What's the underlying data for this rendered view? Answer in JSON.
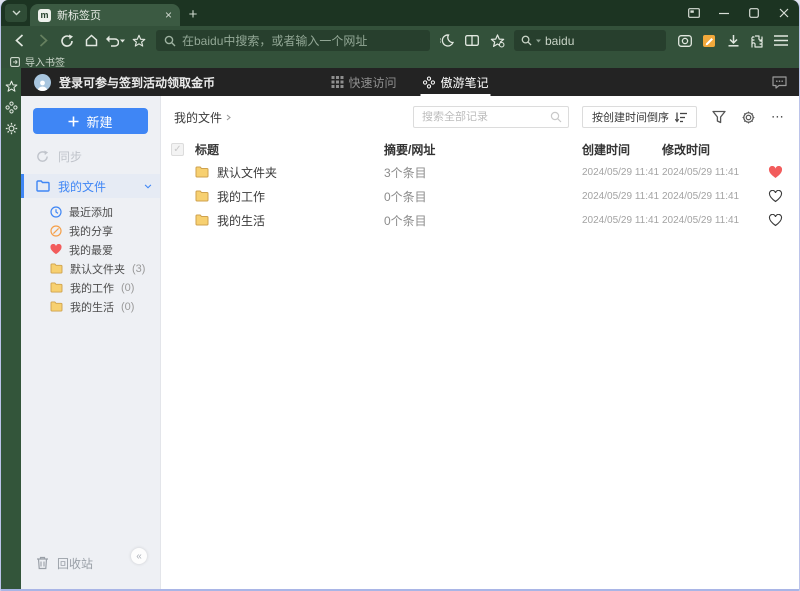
{
  "colors": {
    "titlebar_green": "#1c3422",
    "toolbar_green": "#33513a",
    "field_green": "#273f2d",
    "app_header_dark": "#232323",
    "accent_blue": "#3f86f5",
    "heart_red": "#f25c5c",
    "folder_yellow": "#f7d070",
    "note_orange": "#f2a93b",
    "sidebar_gray": "#eef0f4"
  },
  "icons": {
    "tab_list_chevron": "v",
    "close_x": "×",
    "new_tab_plus": "+",
    "minimize": "─",
    "dropdown_caret": "▾",
    "ellipsis": "⋯",
    "collapse": "«",
    "logo_letter": "m"
  },
  "browser": {
    "tab_title": "新标签页",
    "address_placeholder": "在baidu中搜索，或者输入一个网址",
    "search_engine": "baidu",
    "import_bookmarks": "导入书签"
  },
  "app_header": {
    "login_text": "登录可参与签到活动领取金币",
    "tab_quick_access": "快速访问",
    "tab_notes": "傲游笔记"
  },
  "sidebar": {
    "new_button": "新建",
    "sync": "同步",
    "my_files": "我的文件",
    "items": [
      {
        "label": "最近添加",
        "count": ""
      },
      {
        "label": "我的分享",
        "count": ""
      },
      {
        "label": "我的最爱",
        "count": ""
      },
      {
        "label": "默认文件夹",
        "count": "(3)"
      },
      {
        "label": "我的工作",
        "count": "(0)"
      },
      {
        "label": "我的生活",
        "count": "(0)"
      }
    ],
    "trash": "回收站"
  },
  "content": {
    "breadcrumb": "我的文件",
    "search_placeholder": "搜索全部记录",
    "sort_button": "按创建时间倒序",
    "table": {
      "headers": {
        "title": "标题",
        "summary": "摘要/网址",
        "created": "创建时间",
        "modified": "修改时间"
      },
      "rows": [
        {
          "name": "默认文件夹",
          "summary": "3个条目",
          "created": "2024/05/29 11:41",
          "modified": "2024/05/29 11:41",
          "favorite": true
        },
        {
          "name": "我的工作",
          "summary": "0个条目",
          "created": "2024/05/29 11:41",
          "modified": "2024/05/29 11:41",
          "favorite": false
        },
        {
          "name": "我的生活",
          "summary": "0个条目",
          "created": "2024/05/29 11:41",
          "modified": "2024/05/29 11:41",
          "favorite": false
        }
      ]
    }
  }
}
